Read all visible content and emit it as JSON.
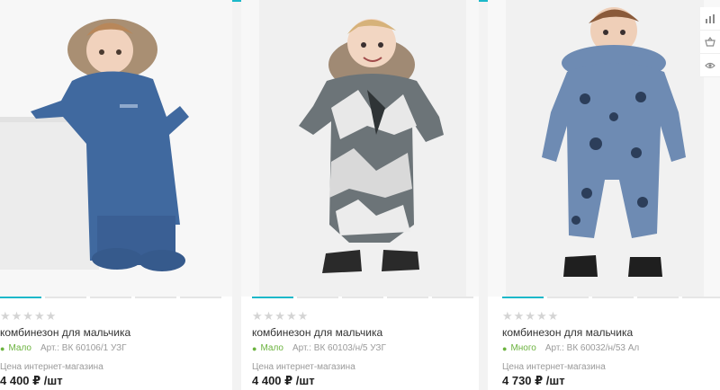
{
  "products": [
    {
      "rating_stars": "★★★★★",
      "title": "комбинезон для мальчика",
      "stock": "Мало",
      "article": "Арт.: ВК 60106/1 УЗГ",
      "price_label": "Цена интернет-магазина",
      "price": "4 400 ₽ /шт",
      "suit_color": "#40699f"
    },
    {
      "rating_stars": "★★★★★",
      "title": "комбинезон для мальчика",
      "stock": "Мало",
      "article": "Арт.: ВК 60103/н/5 УЗГ",
      "price_label": "Цена интернет-магазина",
      "price": "4 400 ₽ /шт",
      "suit_color": "#6c7478"
    },
    {
      "rating_stars": "★★★★★",
      "title": "комбинезон для мальчика",
      "stock": "Много",
      "article": "Арт.: ВК 60032/н/53 Ал",
      "price_label": "Цена интернет-магазина",
      "price": "4 730 ₽ /шт",
      "suit_color": "#6e8bb3"
    }
  ],
  "side_tools": [
    {
      "icon": "bar-chart-icon"
    },
    {
      "icon": "basket-icon"
    },
    {
      "icon": "eye-icon"
    }
  ],
  "colors": {
    "accent": "#1cb8c9",
    "stock_green": "#6cb33f"
  }
}
